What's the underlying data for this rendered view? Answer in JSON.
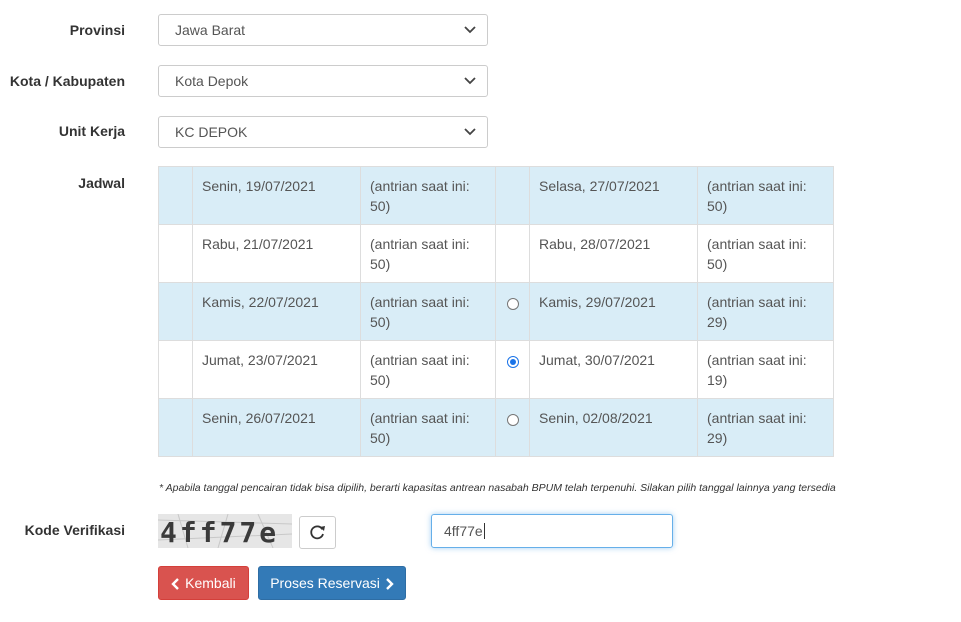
{
  "form": {
    "provinsi": {
      "label": "Provinsi",
      "value": "Jawa Barat"
    },
    "kota": {
      "label": "Kota / Kabupaten",
      "value": "Kota Depok"
    },
    "unit": {
      "label": "Unit Kerja",
      "value": "KC DEPOK"
    },
    "jadwal_label": "Jadwal",
    "kode_label": "Kode Verifikasi"
  },
  "schedule": {
    "rows": [
      {
        "left_date": "Senin, 19/07/2021",
        "left_queue": "(antrian saat ini: 50)",
        "right_radio": "none",
        "right_date": "Selasa, 27/07/2021",
        "right_queue": "(antrian saat ini: 50)"
      },
      {
        "left_date": "Rabu, 21/07/2021",
        "left_queue": "(antrian saat ini: 50)",
        "right_radio": "none",
        "right_date": "Rabu, 28/07/2021",
        "right_queue": "(antrian saat ini: 50)"
      },
      {
        "left_date": "Kamis, 22/07/2021",
        "left_queue": "(antrian saat ini: 50)",
        "right_radio": "unchecked",
        "right_date": "Kamis, 29/07/2021",
        "right_queue": "(antrian saat ini: 29)"
      },
      {
        "left_date": "Jumat, 23/07/2021",
        "left_queue": "(antrian saat ini: 50)",
        "right_radio": "checked",
        "right_date": "Jumat, 30/07/2021",
        "right_queue": "(antrian saat ini: 19)"
      },
      {
        "left_date": "Senin, 26/07/2021",
        "left_queue": "(antrian saat ini: 50)",
        "right_radio": "unchecked",
        "right_date": "Senin, 02/08/2021",
        "right_queue": "(antrian saat ini: 29)"
      }
    ]
  },
  "note": "* Apabila tanggal pencairan tidak bisa dipilih, berarti kapasitas antrean nasabah BPUM telah terpenuhi. Silakan pilih tanggal lainnya yang tersedia",
  "captcha": {
    "text": "4ff77e",
    "input_value": "4ff77e",
    "refresh_icon": "refresh-icon"
  },
  "buttons": {
    "back_label": "Kembali",
    "next_label": "Proses Reservasi",
    "back_icon": "chevron-left-icon",
    "next_icon": "chevron-right-icon"
  },
  "colors": {
    "row_highlight": "#d9edf7",
    "danger": "#d9534f",
    "primary": "#337ab7",
    "radio_checked": "#1a73e8"
  }
}
